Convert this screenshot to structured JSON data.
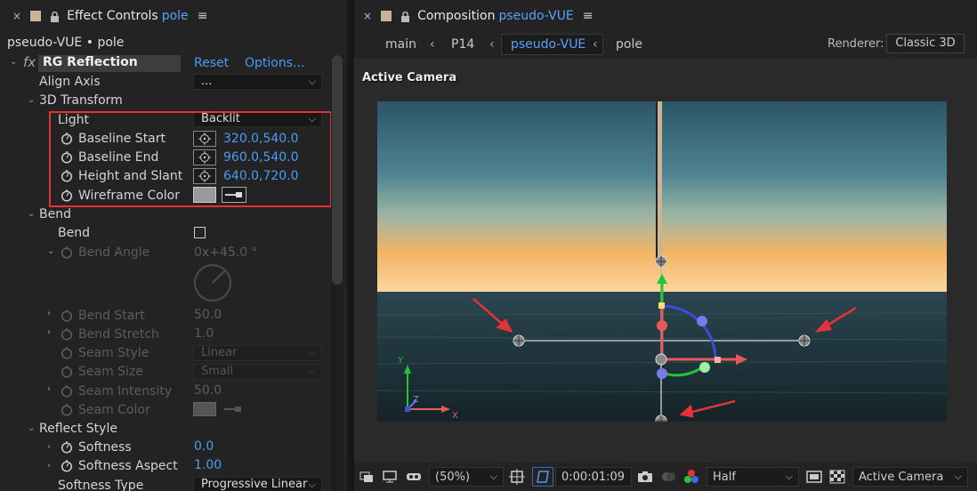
{
  "left_panel": {
    "tab_close": "×",
    "tab_title": "Effect Controls",
    "tab_layer": "pole",
    "menu": "≡",
    "layer_path": "pseudo-VUE • pole",
    "effect": {
      "fx": "fx",
      "name": "RG Reflection",
      "reset": "Reset",
      "options": "Options..."
    },
    "align_axis": {
      "label": "Align Axis",
      "value": "..."
    },
    "transform_group": "3D Transform",
    "light": {
      "label": "Light",
      "value": "Backlit"
    },
    "baseline_start": {
      "label": "Baseline Start",
      "x": "320.0",
      "y": ",540.0"
    },
    "baseline_end": {
      "label": "Baseline End",
      "x": "960.0",
      "y": ",540.0"
    },
    "height_slant": {
      "label": "Height and Slant",
      "x": "640.0",
      "y": ",720.0"
    },
    "wireframe_color": {
      "label": "Wireframe Color"
    },
    "bend_group": "Bend",
    "bend": {
      "label": "Bend"
    },
    "bend_angle": {
      "label": "Bend Angle",
      "value": "0x+45.0 °"
    },
    "bend_start": {
      "label": "Bend Start",
      "value": "50.0"
    },
    "bend_stretch": {
      "label": "Bend Stretch",
      "value": "1.0"
    },
    "seam_style": {
      "label": "Seam Style",
      "value": "Linear"
    },
    "seam_size": {
      "label": "Seam Size",
      "value": "Small"
    },
    "seam_intensity": {
      "label": "Seam Intensity",
      "value": "50.0"
    },
    "seam_color": {
      "label": "Seam Color"
    },
    "reflect_group": "Reflect Style",
    "softness": {
      "label": "Softness",
      "value": "0.0"
    },
    "softness_aspect": {
      "label": "Softness Aspect",
      "value": "1.00"
    },
    "softness_type": {
      "label": "Softness Type",
      "value": "Progressive Linear"
    }
  },
  "right_panel": {
    "tab_close": "×",
    "tab_title": "Composition",
    "tab_comp": "pseudo-VUE",
    "menu": "≡",
    "breadcrumbs": [
      "main",
      "P14",
      "pseudo-VUE",
      "pole"
    ],
    "renderer_label": "Renderer:",
    "renderer_value": "Classic 3D",
    "active_camera_label": "Active Camera",
    "axis_y": "Y",
    "axis_z": "Z",
    "axis_x": "X",
    "bottom": {
      "zoom": "(50%)",
      "timecode": "0:00:01:09",
      "resolution": "Half",
      "view": "Active Camera"
    }
  },
  "colors": {
    "accent_blue": "#4b9cf5",
    "highlight_red": "#e53238",
    "panel_bg": "#232323"
  }
}
